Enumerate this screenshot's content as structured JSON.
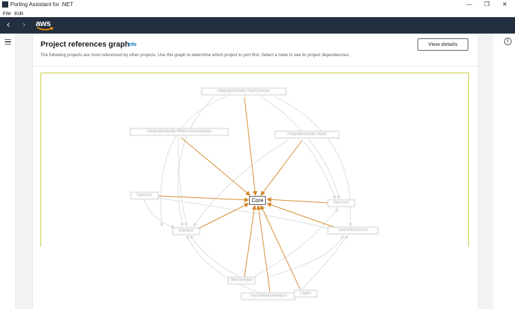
{
  "window": {
    "title": "Porting Assistant for .NET",
    "minimize_glyph": "—",
    "restore_glyph": "❐",
    "close_glyph": "✕"
  },
  "menu": {
    "file": "File",
    "edit": "Edit"
  },
  "nav": {
    "back_glyph": "‹",
    "forward_glyph": "›",
    "logo_text": "aws"
  },
  "panel": {
    "title": "Project references graph",
    "info_link": "Info",
    "description": "The following projects are most referenced by other projects. Use this graph to determine which project to port first. Select a node to see its project dependencies.",
    "view_details_label": "View details"
  },
  "right_rail": {
    "info_glyph": "i"
  },
  "graph": {
    "core_node": "Core",
    "nodes": [
      {
        "id": "n1",
        "label": "IntegrationStudio.TaskCommon"
      },
      {
        "id": "n2",
        "label": "IntegrationStudio.WhileLeaseingTaska"
      },
      {
        "id": "n3",
        "label": "IntegrationStudio.Tasks"
      },
      {
        "id": "n4",
        "label": "Launcher"
      },
      {
        "id": "n5",
        "label": "Net Core"
      },
      {
        "id": "n6",
        "label": "Interface"
      },
      {
        "id": "n7",
        "label": "UserDefined.Core"
      },
      {
        "id": "n8",
        "label": "Net.Interface"
      },
      {
        "id": "n9",
        "label": "UserDefined.Interface"
      },
      {
        "id": "n10",
        "label": "Logger"
      }
    ],
    "edge_color_primary": "#d4882a",
    "edge_color_secondary": "#d5dbdb"
  }
}
